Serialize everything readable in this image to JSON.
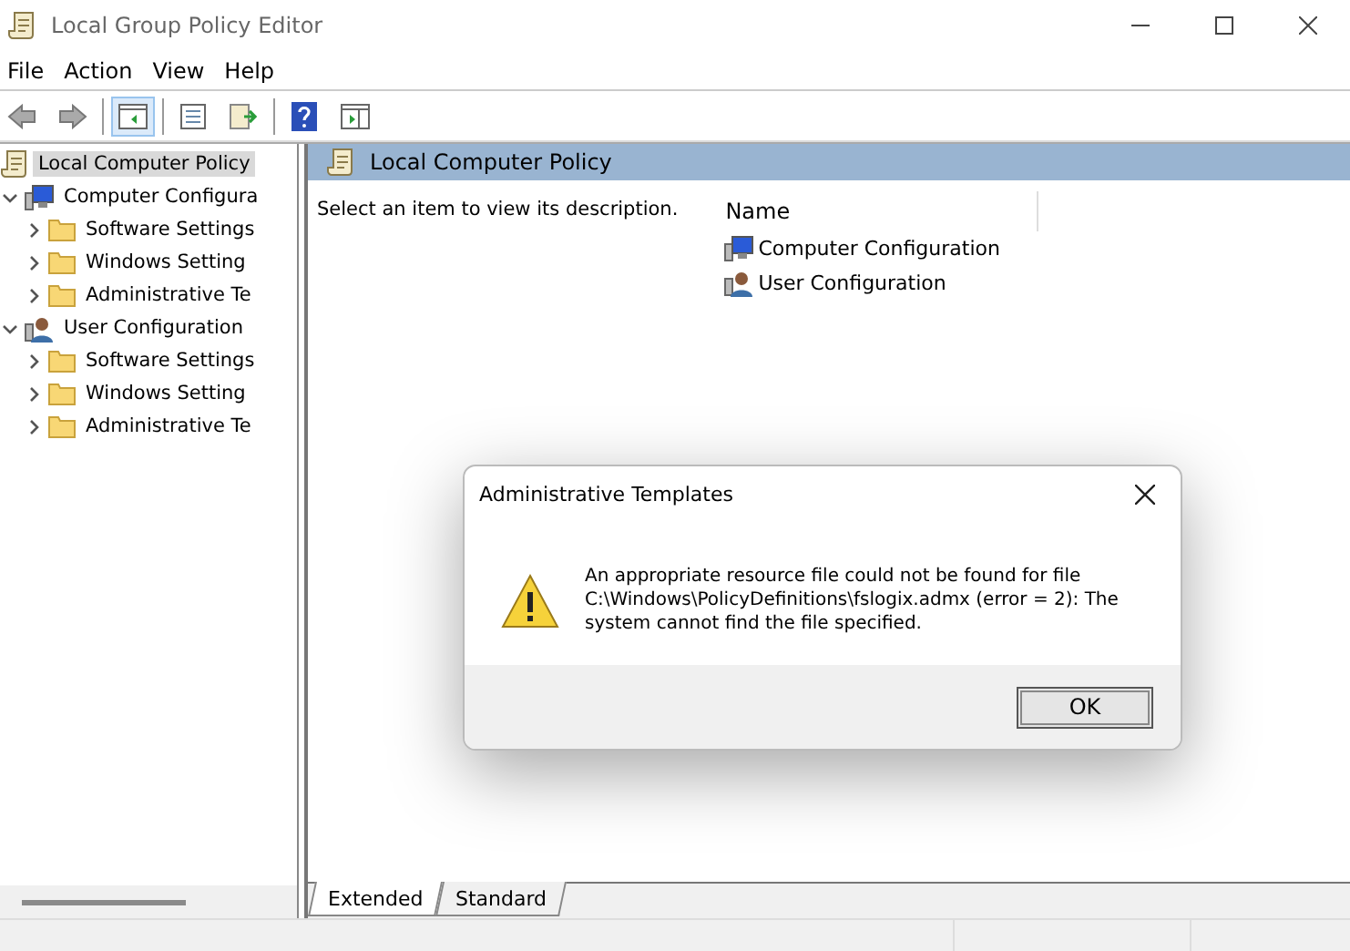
{
  "window": {
    "title": "Local Group Policy Editor"
  },
  "menu": [
    "File",
    "Action",
    "View",
    "Help"
  ],
  "tree": {
    "label": "Local Computer Policy",
    "selected": true,
    "children": [
      {
        "label": "Computer Configura",
        "kind": "computer",
        "expanded": true,
        "selected": false,
        "children": [
          {
            "label": "Software Settings",
            "kind": "folder",
            "expanded": false,
            "selected": false
          },
          {
            "label": "Windows Setting",
            "kind": "folder",
            "expanded": false,
            "selected": false
          },
          {
            "label": "Administrative Te",
            "kind": "folder",
            "expanded": false,
            "selected": false
          }
        ]
      },
      {
        "label": "User Configuration",
        "kind": "user",
        "expanded": true,
        "selected": false,
        "children": [
          {
            "label": "Software Settings",
            "kind": "folder",
            "expanded": false,
            "selected": false
          },
          {
            "label": "Windows Setting",
            "kind": "folder",
            "expanded": false,
            "selected": false
          },
          {
            "label": "Administrative Te",
            "kind": "folder",
            "expanded": false,
            "selected": false
          }
        ]
      }
    ]
  },
  "content": {
    "header": "Local Computer Policy",
    "description": "Select an item to view its description.",
    "columns": [
      "Name"
    ],
    "items": [
      {
        "label": "Computer Configuration",
        "kind": "computer"
      },
      {
        "label": "User Configuration",
        "kind": "user"
      }
    ]
  },
  "tabs": [
    {
      "label": "Extended",
      "selected": true
    },
    {
      "label": "Standard",
      "selected": false
    }
  ],
  "dialog": {
    "title": "Administrative Templates",
    "message": "An appropriate resource file could not be found for file C:\\Windows\\PolicyDefinitions\\fslogix.admx (error = 2): The system cannot find the file specified.",
    "buttons": [
      "OK"
    ]
  }
}
